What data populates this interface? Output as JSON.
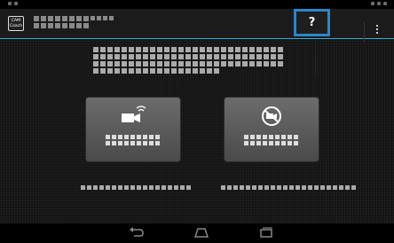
{
  "actionbar": {
    "app_icon_line1": "CAM",
    "app_icon_line2": "Coach",
    "help_label": "?"
  },
  "main": {
    "record_button": {
      "icon": "video-camera-icon"
    },
    "no_camera_button": {
      "icon": "camera-off-icon"
    }
  },
  "navbar": {
    "back_icon": "back-arrow-icon",
    "home_icon": "home-icon",
    "recents_icon": "recent-apps-icon"
  }
}
